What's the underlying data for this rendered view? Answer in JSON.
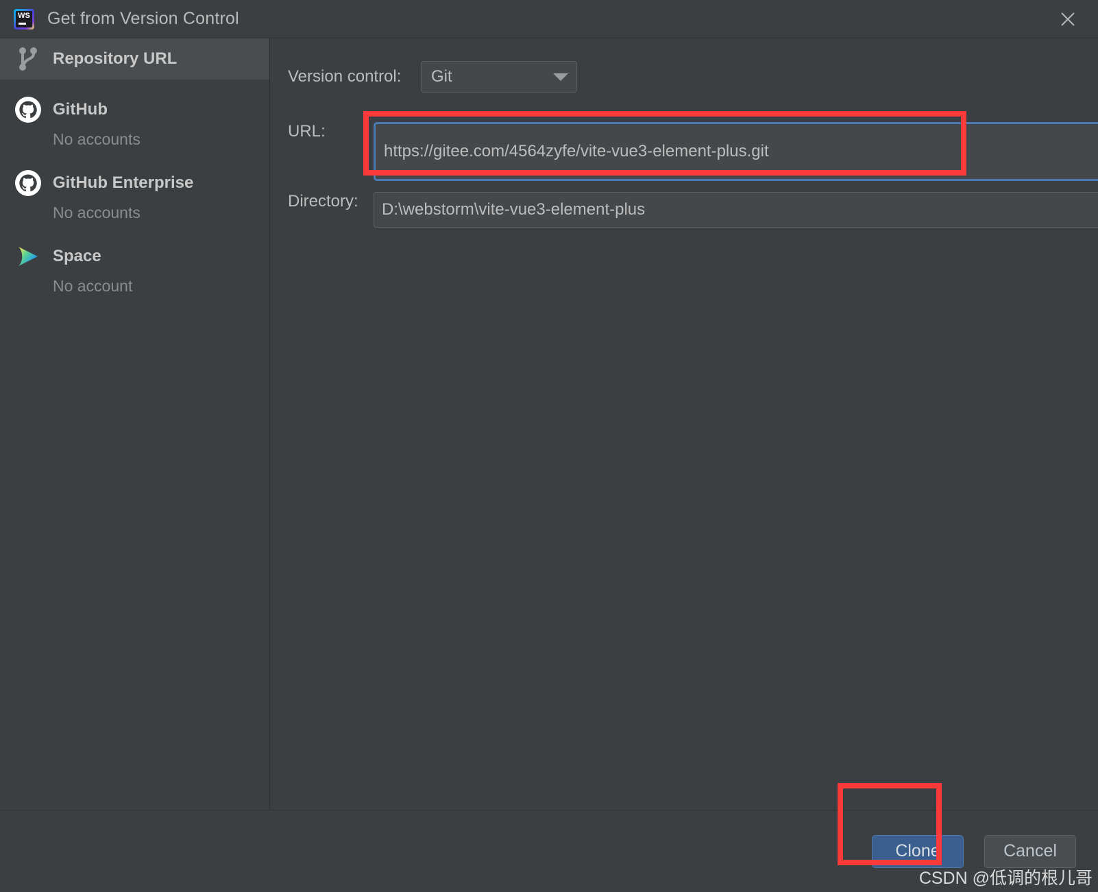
{
  "window": {
    "title": "Get from Version Control",
    "app_icon": "webstorm-logo",
    "app_icon_text": "WS",
    "close_icon": "close-icon"
  },
  "sidebar": {
    "items": [
      {
        "label": "Repository URL",
        "sub": "",
        "icon": "git-branch-icon",
        "selected": true
      },
      {
        "label": "GitHub",
        "sub": "No accounts",
        "icon": "github-icon",
        "selected": false
      },
      {
        "label": "GitHub Enterprise",
        "sub": "No accounts",
        "icon": "github-icon",
        "selected": false
      },
      {
        "label": "Space",
        "sub": "No account",
        "icon": "jetbrains-space-icon",
        "selected": false
      }
    ]
  },
  "form": {
    "version_control": {
      "label": "Version control:",
      "value": "Git",
      "options": [
        "Git"
      ],
      "chevron_icon": "chevron-down-icon"
    },
    "url": {
      "label": "URL:",
      "value": "https://gitee.com/4564zyfe/vite-vue3-element-plus.git",
      "placeholder": "",
      "dropdown_icon": "chevron-down-icon",
      "focused": true,
      "highlighted": true
    },
    "directory": {
      "label": "Directory:",
      "value": "D:\\webstorm\\vite-vue3-element-plus",
      "placeholder": "",
      "browse_icon": "folder-icon"
    }
  },
  "footer": {
    "clone_label": "Clone",
    "cancel_label": "Cancel",
    "clone_highlighted": true
  },
  "watermark": {
    "text": "CSDN @低调的根儿哥"
  },
  "colors": {
    "background": "#3c3f41",
    "field_background": "#45484a",
    "selection": "#4a4d4f",
    "text": "#bcbcbc",
    "muted_text": "#8a8d8f",
    "focus_blue": "#4a7ab5",
    "annotation_red": "#fb3b3b",
    "primary_button": "#3a5f8f"
  }
}
